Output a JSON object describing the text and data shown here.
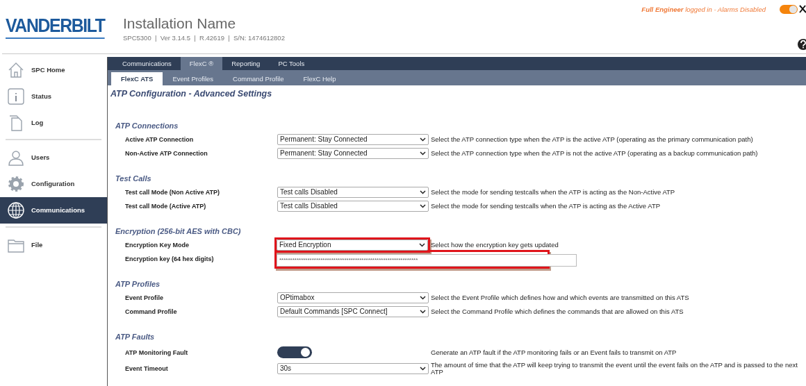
{
  "header": {
    "logo": "VANDERBILT",
    "title": "Installation Name",
    "subtitle": "SPC5300  |  Ver 3.14.5  |  R.42619  |  S/N: 1474612802",
    "login_status": "**Full Engineer** logged in - Alarms Disabled",
    "engineer_toggle": {
      "on": true
    }
  },
  "sidebar": {
    "groups": [
      {
        "items": [
          {
            "label": "SPC Home",
            "selected": false
          },
          {
            "label": "Status",
            "selected": false
          },
          {
            "label": "Log",
            "selected": false
          }
        ]
      },
      {
        "items": [
          {
            "label": "Users",
            "selected": false
          },
          {
            "label": "Configuration",
            "selected": false
          },
          {
            "label": "Communications",
            "selected": true
          }
        ]
      },
      {
        "items": [
          {
            "label": "File",
            "selected": false
          }
        ]
      }
    ]
  },
  "tabs": [
    {
      "label": "Communications",
      "selected": false
    },
    {
      "label": "FlexC ®",
      "selected": true
    },
    {
      "label": "Reporting",
      "selected": false
    },
    {
      "label": "PC Tools",
      "selected": false
    }
  ],
  "subtabs": [
    {
      "label": "FlexC ATS",
      "selected": true
    },
    {
      "label": "Event Profiles",
      "selected": false
    },
    {
      "label": "Command Profile",
      "selected": false
    },
    {
      "label": "FlexC Help",
      "selected": false
    }
  ],
  "page_title": "ATP Configuration - Advanced Settings",
  "sections": [
    {
      "title": "ATP Connections",
      "rows": [
        {
          "label": "Active ATP Connection",
          "kind": "select",
          "value": "Permanent: Stay Connected",
          "description": "Select the ATP connection type when the ATP is the active ATP (operating as the primary communication path)",
          "highlighted": false
        },
        {
          "label": "Non-Active ATP Connection",
          "kind": "select",
          "value": "Permanent: Stay Connected",
          "description": "Select the ATP connection type when the ATP is not the active ATP (operating as a backup communication path)",
          "highlighted": false
        }
      ]
    },
    {
      "title": "Test Calls",
      "rows": [
        {
          "label": "Test call Mode (Non Active ATP)",
          "kind": "select",
          "value": "Test calls Disabled",
          "description": "Select the mode for sending testcalls when the ATP is acting as the Non-Active ATP",
          "highlighted": false
        },
        {
          "label": "Test call Mode (Active ATP)",
          "kind": "select",
          "value": "Test calls Disabled",
          "description": "Select the mode for sending testcalls when the ATP is acting as the Active ATP",
          "highlighted": false
        }
      ]
    },
    {
      "title": "Encryption (256-bit AES with CBC)",
      "rows": [
        {
          "label": "Encryption Key Mode",
          "kind": "select",
          "value": "Fixed Encryption",
          "description": "Select how the encryption key gets updated",
          "highlighted": true
        },
        {
          "label": "Encryption key (64 hex digits)",
          "kind": "text",
          "value": "****************************************************************",
          "highlighted": true
        }
      ]
    },
    {
      "title": "ATP Profiles",
      "rows": [
        {
          "label": "Event Profile",
          "kind": "select",
          "value": "OPtimabox",
          "description": "Select the Event Profile which defines how and which events are transmitted on this ATS",
          "highlighted": false
        },
        {
          "label": "Command Profile",
          "kind": "select",
          "value": "Default Commands [SPC Connect]",
          "description": "Select the Command Profile which defines the commands that are allowed on this ATS",
          "highlighted": false
        }
      ]
    },
    {
      "title": "ATP Faults",
      "rows": [
        {
          "label": "ATP Monitoring Fault",
          "kind": "toggle",
          "on": true,
          "description": "Generate an ATP fault if the ATP monitoring fails or an Event fails to transmit on ATP",
          "highlighted": false
        },
        {
          "label": "Event Timeout",
          "kind": "select",
          "value": "30s",
          "description": "The amount of time that the ATP will keep trying to transmit the event until the event fails on the ATP and is passed to the next ATP",
          "highlighted": false
        }
      ]
    }
  ]
}
